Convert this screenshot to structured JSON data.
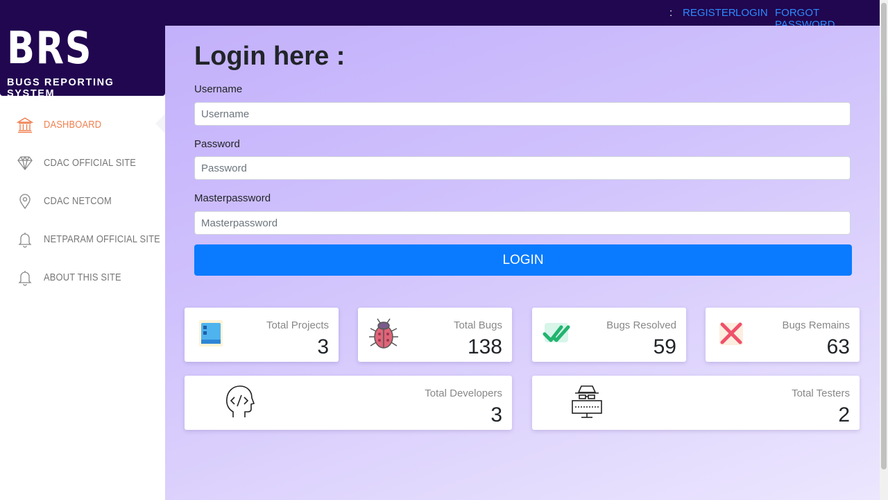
{
  "header": {
    "separator": ":",
    "links": [
      "REGISTER",
      "LOGIN",
      "FORGOT PASSWORD"
    ]
  },
  "logo": {
    "brand": "BRS",
    "tagline": "BUGS REPORTING SYSTEM"
  },
  "sidebar": {
    "items": [
      {
        "label": "DASHBOARD",
        "icon": "bank-icon",
        "active": true
      },
      {
        "label": "CDAC OFFICIAL SITE",
        "icon": "diamond-icon",
        "active": false
      },
      {
        "label": "CDAC NETCOM",
        "icon": "location-pin-icon",
        "active": false
      },
      {
        "label": "NETPARAM OFFICIAL SITE",
        "icon": "bell-icon",
        "active": false
      },
      {
        "label": "ABOUT THIS SITE",
        "icon": "bell-icon",
        "active": false
      }
    ]
  },
  "login": {
    "title": "Login here :",
    "username_label": "Username",
    "username_placeholder": "Username",
    "password_label": "Password",
    "password_placeholder": "Password",
    "masterpassword_label": "Masterpassword",
    "masterpassword_placeholder": "Masterpassword",
    "submit_label": "LOGIN"
  },
  "stats": {
    "total_projects": {
      "label": "Total Projects",
      "value": "3",
      "icon": "window-icon"
    },
    "total_bugs": {
      "label": "Total Bugs",
      "value": "138",
      "icon": "bug-icon"
    },
    "bugs_resolved": {
      "label": "Bugs Resolved",
      "value": "59",
      "icon": "double-check-icon"
    },
    "bugs_remains": {
      "label": "Bugs Remains",
      "value": "63",
      "icon": "cross-icon"
    },
    "total_developers": {
      "label": "Total Developers",
      "value": "3",
      "icon": "developer-head-icon"
    },
    "total_testers": {
      "label": "Total Testers",
      "value": "2",
      "icon": "tester-spy-icon"
    }
  },
  "colors": {
    "header_bg": "#210650",
    "link": "#2b8cff",
    "active_nav": "#f08050",
    "primary_button": "#0a7bff"
  }
}
